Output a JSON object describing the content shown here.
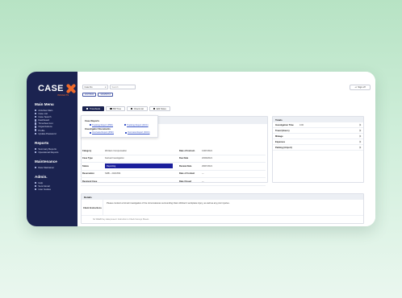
{
  "brand": {
    "logo_text": "CASE",
    "logo_sub": "INSIGHTS"
  },
  "sidebar": {
    "main_menu_title": "Main Menu",
    "main_items": [
      "Activities Main",
      "Case List",
      "Case Search",
      "Dashboard",
      "Timesheet List",
      "Organizations",
      "Profile",
      "Update Password"
    ],
    "reports_title": "Reports",
    "reports_items": [
      "Summary Reports",
      "Operational Reports"
    ],
    "maintenance_title": "Maintenance",
    "maintenance_items": [
      "Rate Maintainer"
    ],
    "admin_title": "Admin.",
    "admin_items": [
      "Help",
      "Send Email",
      "User Guides"
    ]
  },
  "topbar": {
    "select_value": "Case No",
    "search_placeholder": "Search",
    "signout_label": "Sign off"
  },
  "chips": [
    "2017/6624",
    "1234/56712"
  ],
  "tabs": [
    "Timesheets",
    "Bill Time",
    "Check List",
    "Edit Notes"
  ],
  "popup": {
    "case_reports_title": "Case Reports",
    "case_reports_links": [
      "Tracking Report (PDF)",
      "Tracking Report (DOC)"
    ],
    "investigator_title": "Investigator Documents",
    "investigator_links": [
      "Overview Report (PDF)",
      "Overview Report (DOC)"
    ]
  },
  "details": {
    "rows": [
      {
        "label": "Category",
        "value": "Workers Compensation",
        "label2": "Date of Instruct.",
        "value2": "13/07/2021"
      },
      {
        "label": "Case Type",
        "value": "Factual Investigation",
        "label2": "Due Date",
        "value2": "20/09/2021"
      },
      {
        "label": "Status",
        "value": "Reporting",
        "label2": "Review Date",
        "value2": "29/07/2021"
      },
      {
        "label": "Reservation",
        "value": "SMB – 2021/654",
        "label2": "Date of Contact",
        "value2": "—"
      },
      {
        "label": "Received Case",
        "value": "",
        "label2": "Date Closed",
        "value2": "—"
      }
    ]
  },
  "totals": {
    "title": "Totals",
    "rows": [
      {
        "label": "Investigation Time",
        "value": "0.00"
      },
      {
        "label": "Travel (Hours)",
        "value": ""
      },
      {
        "label": "Mileage",
        "value": ""
      },
      {
        "label": "Expenses",
        "value": ""
      },
      {
        "label": "Parking (Airport)",
        "value": ""
      }
    ]
  },
  "notes": {
    "title": "Details",
    "client_instructions_label": "Client Instructions",
    "client_instructions_text": "Please conduct a formal investigation of the circumstances surrounding Claim Worker's workplace injury, as well as any prior injuries.",
    "footer_note": "No WAEB Key data present: Instruction to Check Surveys Sheets"
  }
}
